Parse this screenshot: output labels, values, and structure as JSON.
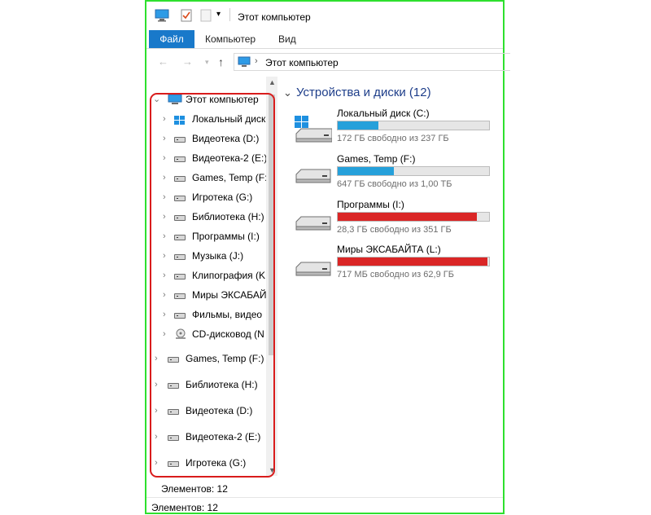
{
  "window": {
    "title": "Этот компьютер"
  },
  "ribbon": {
    "tabs": [
      "Файл",
      "Компьютер",
      "Вид"
    ]
  },
  "address": {
    "path": "Этот компьютер"
  },
  "nav": {
    "root": "Этот компьютер",
    "items": [
      "Локальный диск",
      "Видеотека (D:)",
      "Видеотека-2 (E:)",
      "Games, Temp (F:",
      "Игротека (G:)",
      "Библиотека (H:)",
      "Программы (I:)",
      "Музыка (J:)",
      "Клипография (K",
      "Миры ЭКСАБАЙ",
      "Фильмы, видео",
      "CD-дисковод (N"
    ],
    "pinned": [
      "Games, Temp (F:)",
      "Библиотека (H:)",
      "Видеотека (D:)",
      "Видеотека-2 (E:)",
      "Игротека (G:)"
    ]
  },
  "content": {
    "group_title": "Устройства и диски (12)",
    "drives": [
      {
        "name": "Локальный диск (C:)",
        "space": "172 ГБ свободно из 237 ГБ",
        "used_fraction": 0.27,
        "color": "#26a0da",
        "icon": "windows-drive"
      },
      {
        "name": "Games, Temp (F:)",
        "space": "647 ГБ свободно из 1,00 ТБ",
        "used_fraction": 0.37,
        "color": "#26a0da",
        "icon": "drive"
      },
      {
        "name": "Программы (I:)",
        "space": "28,3 ГБ свободно из 351 ГБ",
        "used_fraction": 0.92,
        "color": "#da2626",
        "icon": "drive"
      },
      {
        "name": "Миры ЭКСАБАЙТА (L:)",
        "space": "717 МБ свободно из 62,9 ГБ",
        "used_fraction": 0.99,
        "color": "#da2626",
        "icon": "drive"
      }
    ]
  },
  "status": {
    "nav_count": "Элементов: 12",
    "count": "Элементов: 12"
  }
}
